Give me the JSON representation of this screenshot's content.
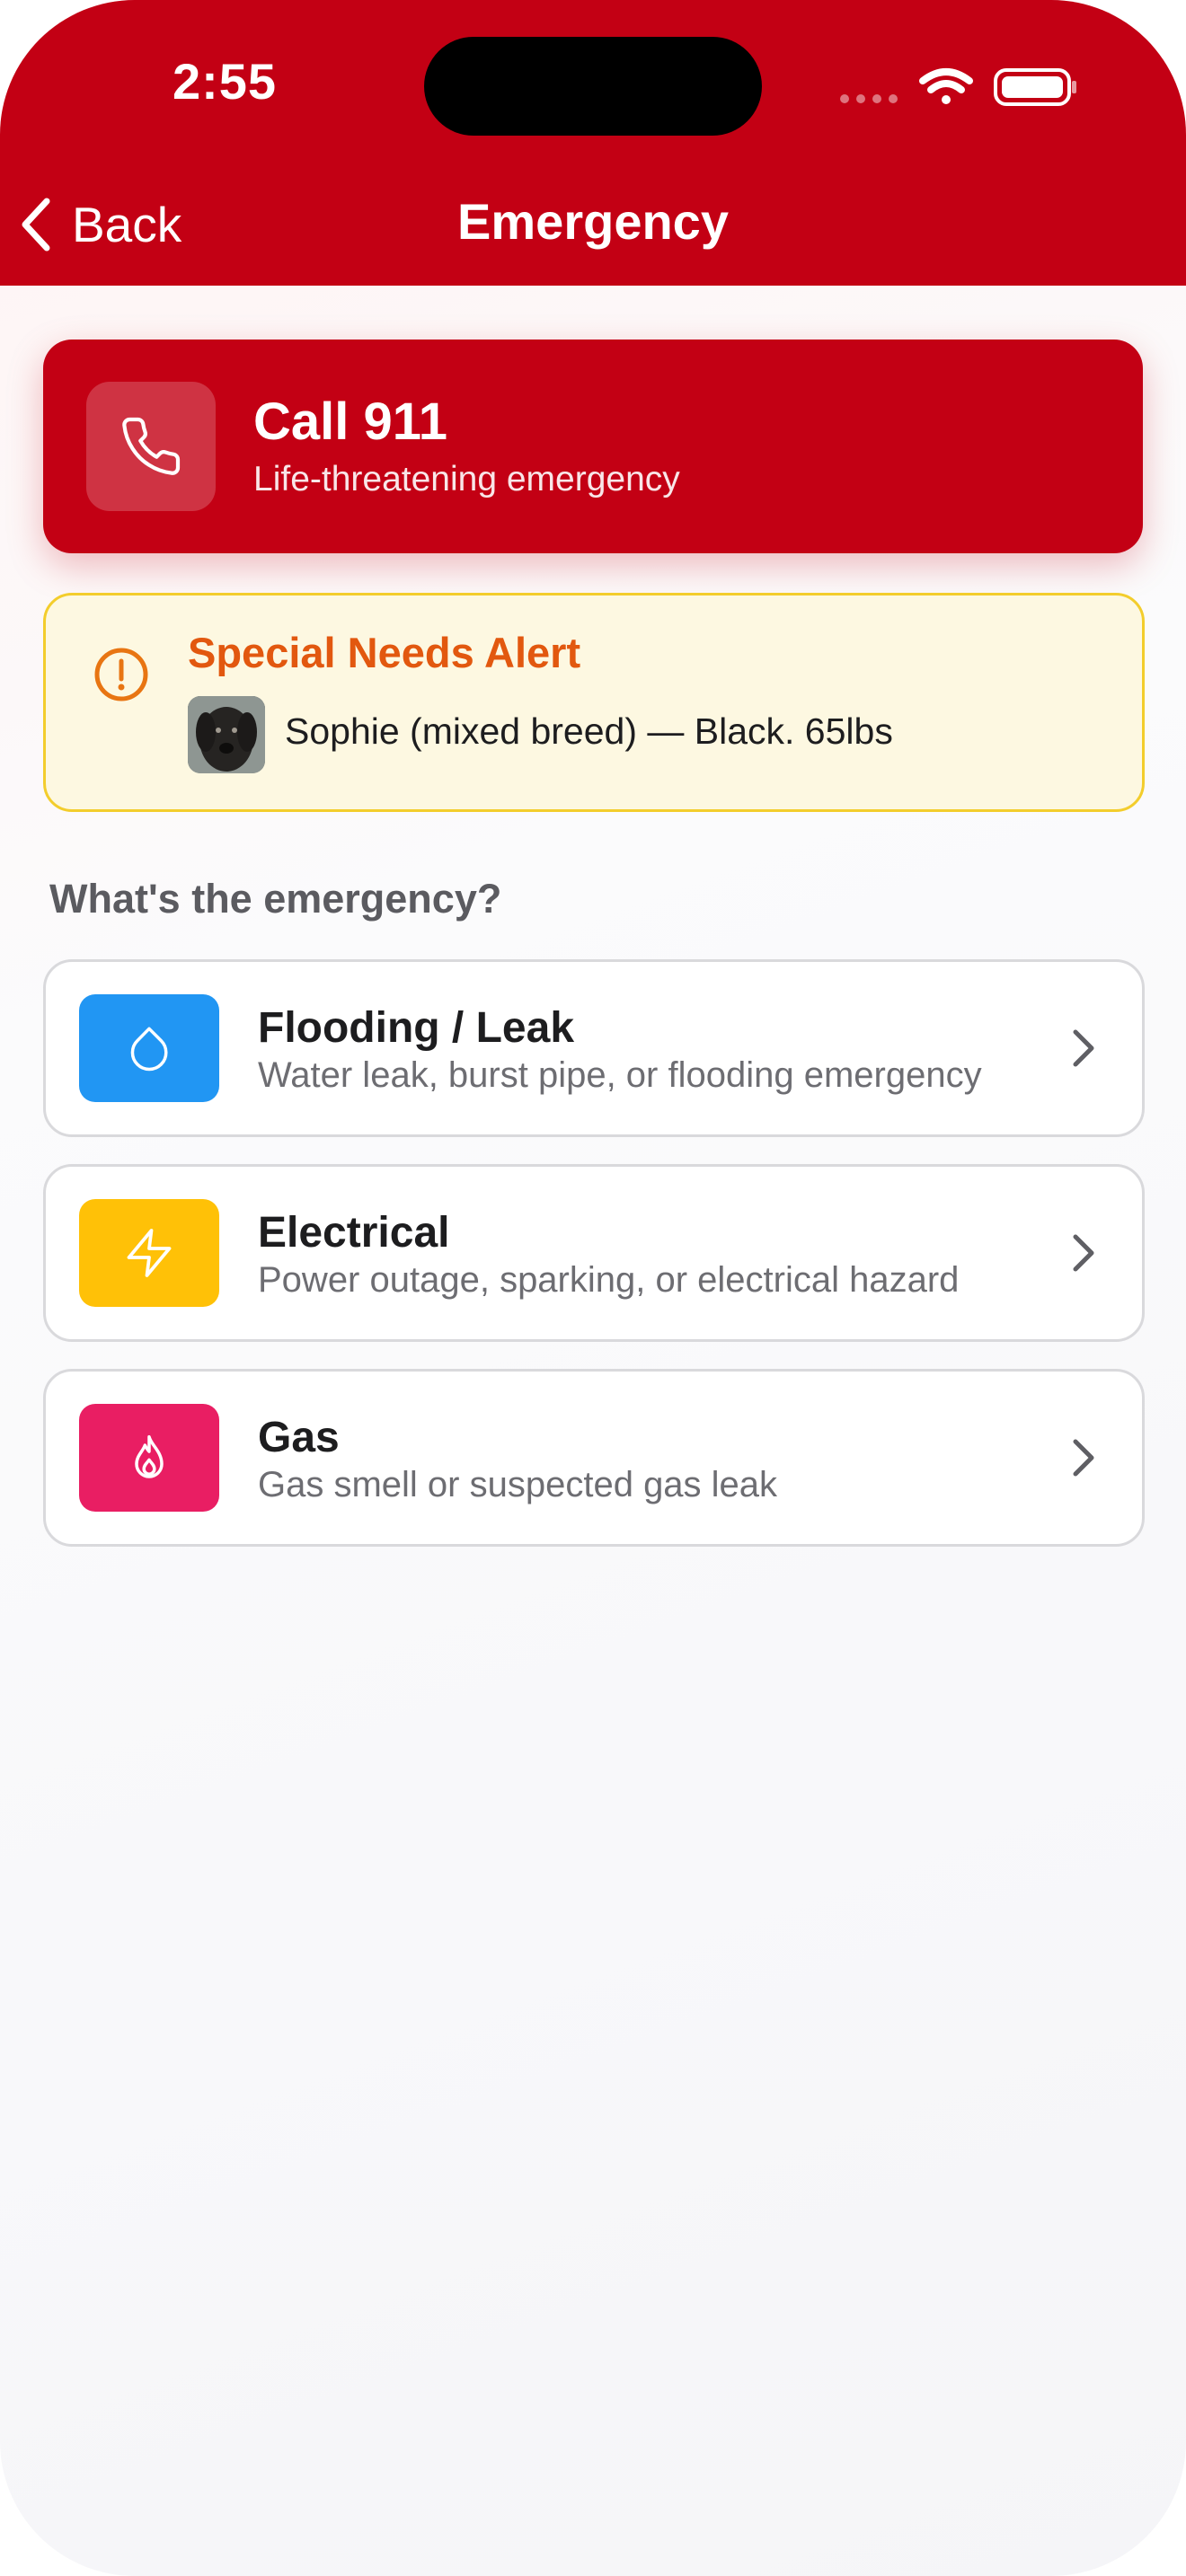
{
  "status_bar": {
    "time": "2:55"
  },
  "nav": {
    "back_label": "Back",
    "title": "Emergency"
  },
  "call_card": {
    "title": "Call 911",
    "subtitle": "Life-threatening emergency",
    "icon": "phone-icon"
  },
  "alert": {
    "title": "Special Needs Alert",
    "pet_text": "Sophie (mixed breed) — Black. 65lbs",
    "icon": "exclamation-circle-icon"
  },
  "section": {
    "heading": "What's the emergency?"
  },
  "options": [
    {
      "title": "Flooding / Leak",
      "description": "Water leak, burst pipe, or flooding emergency",
      "icon": "water-drop-icon",
      "color": "#2196f3"
    },
    {
      "title": "Electrical",
      "description": "Power outage, sparking, or electrical hazard",
      "icon": "lightning-bolt-icon",
      "color": "#ffc107"
    },
    {
      "title": "Gas",
      "description": "Gas smell or suspected gas leak",
      "icon": "flame-icon",
      "color": "#e91e63"
    }
  ],
  "colors": {
    "brand_red": "#c30014",
    "alert_orange": "#e2580f",
    "alert_bg": "#fdf8e1",
    "alert_border": "#f3cd2c"
  }
}
